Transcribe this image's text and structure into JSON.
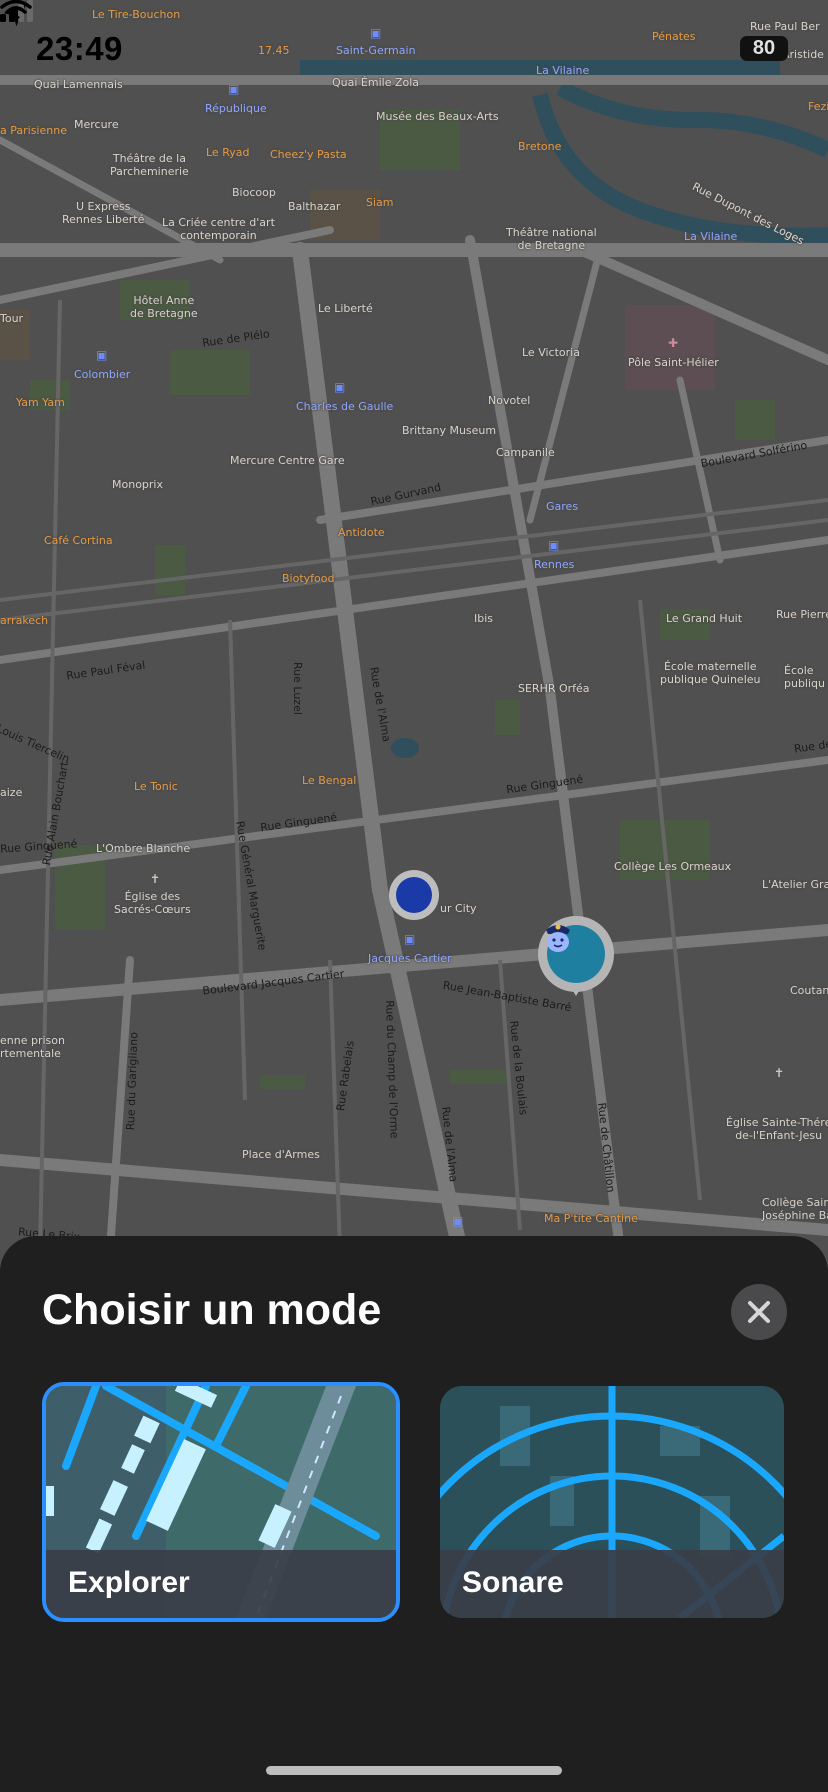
{
  "status_bar": {
    "time": "23:49",
    "battery": "80"
  },
  "map": {
    "labels": {
      "tire_bouchon": "Le Tire-Bouchon",
      "t1745": "17.45",
      "saint_germain": "Saint-Germain",
      "penates": "Pénates",
      "rue_paul_bert": "Rue Paul Ber",
      "aristide": "Aristide",
      "quai_lamennais": "Quai Lamennais",
      "quai_emile_zola": "Quai Émile Zola",
      "la_vilaine_1": "La Vilaine",
      "republique": "République",
      "mercure": "Mercure",
      "musee_beaux_arts": "Musée des Beaux-Arts",
      "fezi": "Fezi",
      "parisienne": "a Parisienne",
      "le_ryad": "Le Ryad",
      "cheezy_pasta": "Cheez'y Pasta",
      "bretone": "Bretone",
      "theatre_parcheminerie": "Théâtre de la\nParcheminerie",
      "biocoop": "Biocoop",
      "balthazar": "Balthazar",
      "siam": "Siam",
      "rue_dupont_loges": "Rue Dupont des Loges",
      "u_express": "U Express\nRennes Liberté",
      "criee": "La Criée centre d'art\ncontemporain",
      "theatre_national": "Théâtre national\nde Bretagne",
      "la_vilaine_2": "La Vilaine",
      "hotel_anne": "Hôtel Anne\nde Bretagne",
      "le_liberte": "Le Liberté",
      "tour": "Tour",
      "rue_plelo": "Rue de Plélo",
      "le_victoria": "Le Victoria",
      "pole_saint_helier": "Pôle Saint-Hélier",
      "colombier": "Colombier",
      "yam_yam": "Yam Yam",
      "charles_de_gaulle": "Charles de Gaulle",
      "novotel": "Novotel",
      "brittany_museum": "Brittany Museum",
      "boulevard_solferino": "Boulevard Solférino",
      "mercure_gare": "Mercure Centre Gare",
      "campanile": "Campanile",
      "monoprix": "Monoprix",
      "rue_gurvand": "Rue Gurvand",
      "gares": "Gares",
      "cafe_cortina": "Café Cortina",
      "antidote": "Antidote",
      "rennes": "Rennes",
      "biotyfood": "Biotyfood",
      "le_grand_huit": "Le Grand Huit",
      "rue_pierre": "Rue Pierre",
      "arrakech": "arrakech",
      "ibis": "Ibis",
      "ecole_quineleu": "École maternelle\npublique Quineleu",
      "ecole_right": "École\npubliqu",
      "rue_paul_feval": "Rue Paul Féval",
      "rue_luzel": "Rue Luzel",
      "rue_alma": "Rue de l'Alma",
      "serhr_orfea": "SERHR Orféa",
      "louis_tiercelin": "Louis Tiercelin",
      "rue_de": "Rue de",
      "le_tonic": "Le Tonic",
      "le_bengal": "Le Bengal",
      "rue_ginguene_1": "Rue Ginguené",
      "aize": "aize",
      "rue_ginguene_2": "Rue Ginguené",
      "rue_general_marguerite": "Rue Général Marguerite",
      "rue_ginguene_3": "Rue Ginguené",
      "ombre_blanche": "L'Ombre Blanche",
      "college_ormeaux": "Collège Les Ormeaux",
      "atelier_gra": "L'Atelier Gra",
      "rue_alain_bouchart": "Rue Alain Bouchart",
      "eglise_sacres_coeurs": "Église des\nSacrés-Cœurs",
      "jacques_cartier": "Jacques Cartier",
      "ur_city": "ur City",
      "boulevard_jacques_cartier": "Boulevard Jacques Cartier",
      "rue_jean_baptiste_barre": "Rue Jean-Baptiste Barré",
      "coutan": "Coutan",
      "ancienne_prison": "enne prison\nrtementale",
      "rue_du_champ_orme": "Rue du Champ de l'Orme",
      "rue_boulais": "Rue de la Boulais",
      "rue_garigliano": "Rue du Garigliano",
      "rue_rabelais": "Rue Rabelais",
      "rue_alma_2": "Rue de l'Alma",
      "rue_chatillon": "Rue de Châtillon",
      "eglise_sainte_therese": "Église Sainte-Thére\nde-l'Enfant-Jesu",
      "place_armes": "Place d'Armes",
      "college_saint_josephine": "Collège Sain\nJoséphine Bak",
      "rue_le_brix": "Rue Le Brix",
      "ma_ptite_cantine": "Ma P'tite Cantine"
    }
  },
  "sheet": {
    "title": "Choisir un mode",
    "modes": [
      {
        "label": "Explorer",
        "selected": true
      },
      {
        "label": "Sonare",
        "selected": false
      }
    ]
  },
  "colors": {
    "accent": "#2b8fff",
    "sheet_background": "#1f1f1f",
    "map_dim": "#4f4f4f",
    "user_dot": "#1a3aa7"
  }
}
